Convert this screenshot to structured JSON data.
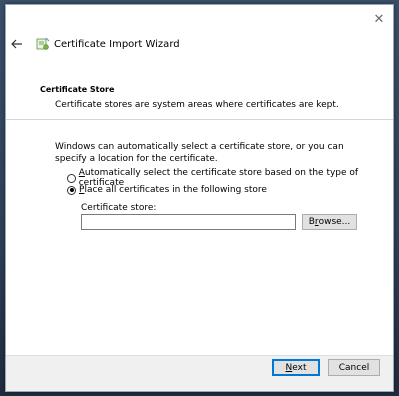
{
  "window": {
    "title": "Certificate Import Wizard",
    "close_glyph": "✕"
  },
  "section": {
    "title": "Certificate Store",
    "description": "Certificate stores are system areas where certificates are kept."
  },
  "intro": "Windows can automatically select a certificate store, or you can specify a location for the certificate.",
  "options": {
    "auto": {
      "label_prefix": "",
      "label_mnemonic": "A",
      "label_rest": "utomatically select the certificate store based on the type of certificate",
      "checked": false
    },
    "manual": {
      "label_prefix": "",
      "label_mnemonic": "P",
      "label_rest": "lace all certificates in the following store",
      "checked": true
    }
  },
  "store": {
    "label": "Certificate store:",
    "value": "",
    "browse_prefix": "B",
    "browse_mnemonic": "r",
    "browse_rest": "owse..."
  },
  "footer": {
    "next_mnemonic": "N",
    "next_rest": "ext",
    "cancel_label": "Cancel"
  },
  "icons": {
    "back": "back-arrow-icon",
    "wizard": "certificate-wizard-icon",
    "close": "close-icon"
  }
}
